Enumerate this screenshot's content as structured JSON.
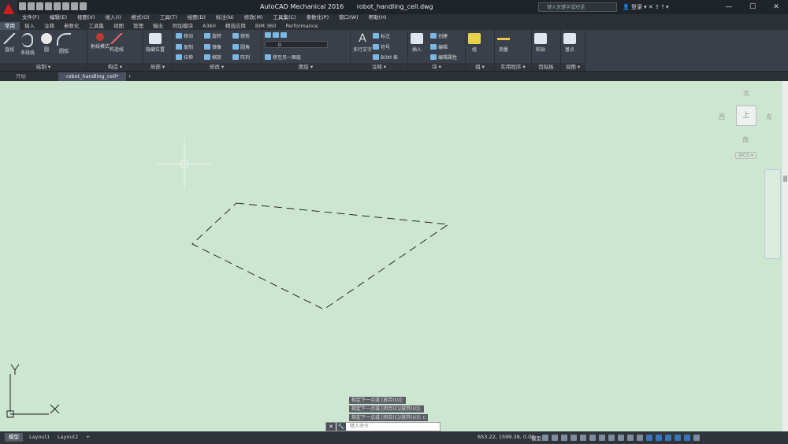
{
  "app": {
    "title": "AutoCAD Mechanical 2016",
    "filename": "robot_handling_cell.dwg",
    "search_placeholder": "键入关键字或短语",
    "login_label": "登录"
  },
  "menu": [
    "文件(F)",
    "编辑(E)",
    "视图(V)",
    "插入(I)",
    "格式(O)",
    "工具(T)",
    "绘图(D)",
    "标注(N)",
    "修改(M)",
    "工具集(C)",
    "参数化(P)",
    "窗口(W)",
    "帮助(H)"
  ],
  "ribbon_tabs": [
    "常用",
    "插入",
    "注释",
    "参数化",
    "工具集",
    "视图",
    "管理",
    "输出",
    "附加模块",
    "A360",
    "精选应用",
    "BIM 360",
    "Performance"
  ],
  "ribbon": {
    "draw": {
      "title": "绘制",
      "line": "直线",
      "polyline": "多段线",
      "circle": "圆",
      "arc": "圆弧"
    },
    "construct": {
      "title": "构造",
      "ortho": "射线模式",
      "construct": "构造线"
    },
    "detail": {
      "title": "局部",
      "hide": "隐藏位置"
    },
    "modify": {
      "title": "修改",
      "move": "移动",
      "rotate": "旋转",
      "trim": "修剪",
      "copy": "复制",
      "mirror": "镜像",
      "fillet": "圆角",
      "stretch": "拉伸",
      "scale": "缩放",
      "array": "阵列"
    },
    "layers": {
      "title": "图层",
      "current": "0",
      "match": "移至另一图层"
    },
    "annotation": {
      "title": "注释",
      "mtext": "多行文字",
      "dim": "标注",
      "symbol": "符号",
      "bom": "BOM 表"
    },
    "block": {
      "title": "块",
      "insert": "插入",
      "create": "创建",
      "edit": "编辑",
      "attrib": "编辑属性"
    },
    "groups": {
      "title": "组",
      "group": "组"
    },
    "utilities": {
      "title": "实用程序",
      "measure": "测量"
    },
    "clipboard": {
      "title": "剪贴板",
      "paste": "粘贴"
    },
    "view": {
      "title": "视图",
      "base": "基点"
    }
  },
  "doc_tabs": {
    "start": "开始",
    "current": "robot_handling_cell*"
  },
  "viewcube": {
    "north": "北",
    "south": "南",
    "east": "东",
    "west": "西",
    "top": "上",
    "wcs": "WCS"
  },
  "command": {
    "history": [
      "指定下一点或 [放弃(U)]:",
      "指定下一点或 [闭合(C)/放弃(U)]:",
      "指定下一点或 [闭合(C)/放弃(U)]: c"
    ],
    "placeholder": "键入命令"
  },
  "status": {
    "tabs": [
      "模型",
      "Layout1",
      "Layout2"
    ],
    "coordinates": "653.22, 1599.38, 0.00",
    "mode": "模型"
  },
  "drawing": {
    "line_color": "#2a2a2a",
    "canvas_color": "#cce6d2"
  }
}
